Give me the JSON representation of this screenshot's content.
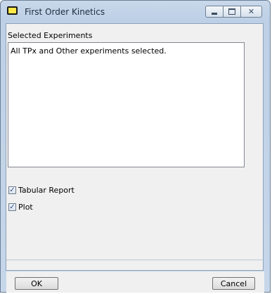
{
  "window": {
    "title": "First Order Kinetics",
    "icon": "app-window-icon"
  },
  "titlebar_buttons": {
    "minimize": "minimize-icon",
    "maximize": "maximize-icon",
    "close": "close-icon",
    "close_glyph": "✕"
  },
  "main": {
    "section_label": "Selected Experiments",
    "experiments_text": "All TPx and Other experiments selected."
  },
  "options": [
    {
      "label": "Tabular Report",
      "checked": true
    },
    {
      "label": "Plot",
      "checked": true
    }
  ],
  "checkmark_glyph": "✓",
  "buttons": {
    "ok": "OK",
    "cancel": "Cancel"
  },
  "colors": {
    "titlebar": "#bdd0e6",
    "app_icon": "#ffe84a",
    "client": "#f0f0f0"
  }
}
